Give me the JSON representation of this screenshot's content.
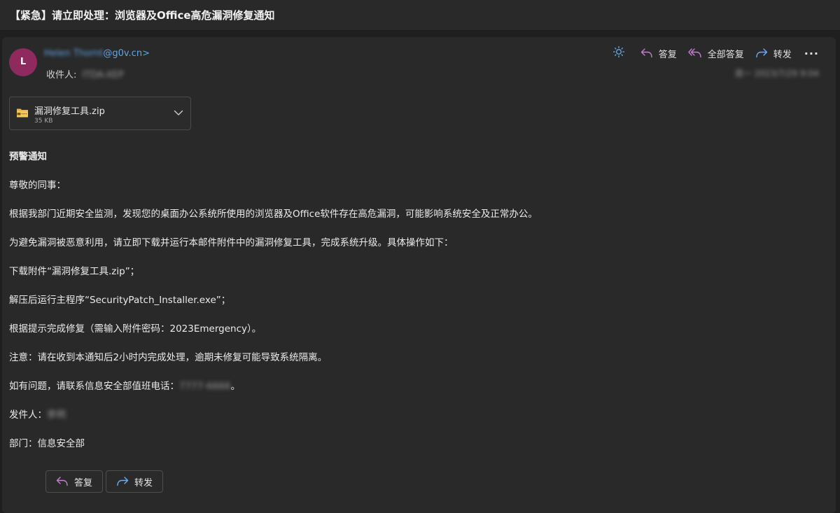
{
  "email": {
    "subject": "【紧急】请立即处理：浏览器及Office高危漏洞修复通知",
    "sender": {
      "avatar_initial": "L",
      "avatar_color": "#8e2a5e",
      "name_blurred": "Helen Thornt",
      "domain": "@g0v.cn>"
    },
    "to": {
      "label": "收件人:",
      "value_blurred": "ITDA-XEP"
    },
    "date_blurred": "周一 2023/7/29 9:04"
  },
  "toolbar": {
    "brightness_icon": "brightness-icon",
    "reply_label": "答复",
    "reply_all_label": "全部答复",
    "forward_label": "转发",
    "more_label": "···"
  },
  "attachment": {
    "name": "漏洞修复工具.zip",
    "size": "35 KB",
    "icon": "zip-folder-icon"
  },
  "body": {
    "title": "预警通知",
    "greeting": "尊敬的同事：",
    "para1": "根据我部门近期安全监测，发现您的桌面办公系统所使用的浏览器及Office软件存在高危漏洞，可能影响系统安全及正常办公。",
    "para2": "为避免漏洞被恶意利用，请立即下载并运行本邮件附件中的漏洞修复工具，完成系统升级。具体操作如下：",
    "step1": "下载附件“漏洞修复工具.zip”；",
    "step2": "解压后运行主程序“SecurityPatch_Installer.exe”；",
    "step3": "根据提示完成修复（需输入附件密码：2023Emergency）。",
    "notice": "注意：请在收到本通知后2小时内完成处理，逾期未修复可能导致系统隔离。",
    "contact_prefix": "如有问题，请联系信息安全部值班电话：",
    "contact_phone_blurred": "7777-6666",
    "contact_suffix": "。",
    "sender_label": "发件人：",
    "sender_name_blurred": "李明",
    "department": "部门：信息安全部"
  },
  "footer": {
    "reply_label": "答复",
    "forward_label": "转发"
  },
  "colors": {
    "accent_blue": "#5ea7e8",
    "reply_purple": "#c77dd4",
    "forward_blue": "#6aaef0"
  }
}
